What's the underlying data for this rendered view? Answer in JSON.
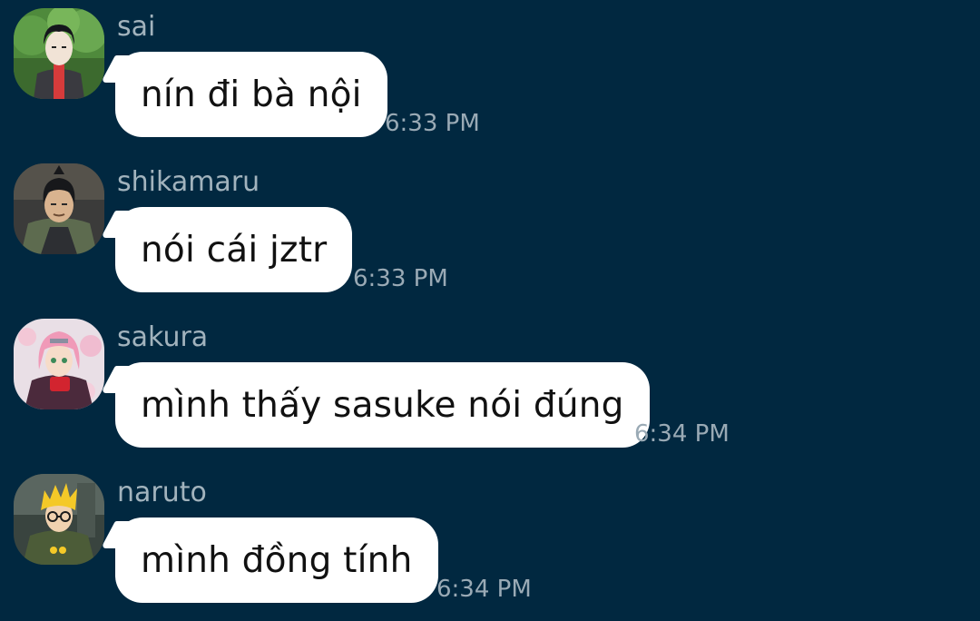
{
  "messages": [
    {
      "sender": "sai",
      "text": "nín đi bà nội",
      "time": "6:33 PM",
      "avatar_icon": "sai-avatar"
    },
    {
      "sender": "shikamaru",
      "text": "nói cái jztr",
      "time": "6:33 PM",
      "avatar_icon": "shikamaru-avatar"
    },
    {
      "sender": "sakura",
      "text": "mình thấy sasuke nói đúng",
      "time": "6:34 PM",
      "avatar_icon": "sakura-avatar"
    },
    {
      "sender": "naruto",
      "text": "mình đồng tính",
      "time": "6:34 PM",
      "avatar_icon": "naruto-avatar"
    }
  ],
  "colors": {
    "background": "#012840",
    "bubble": "#ffffff",
    "sender_name": "#a2b3bd",
    "timestamp": "#9aaab5"
  }
}
